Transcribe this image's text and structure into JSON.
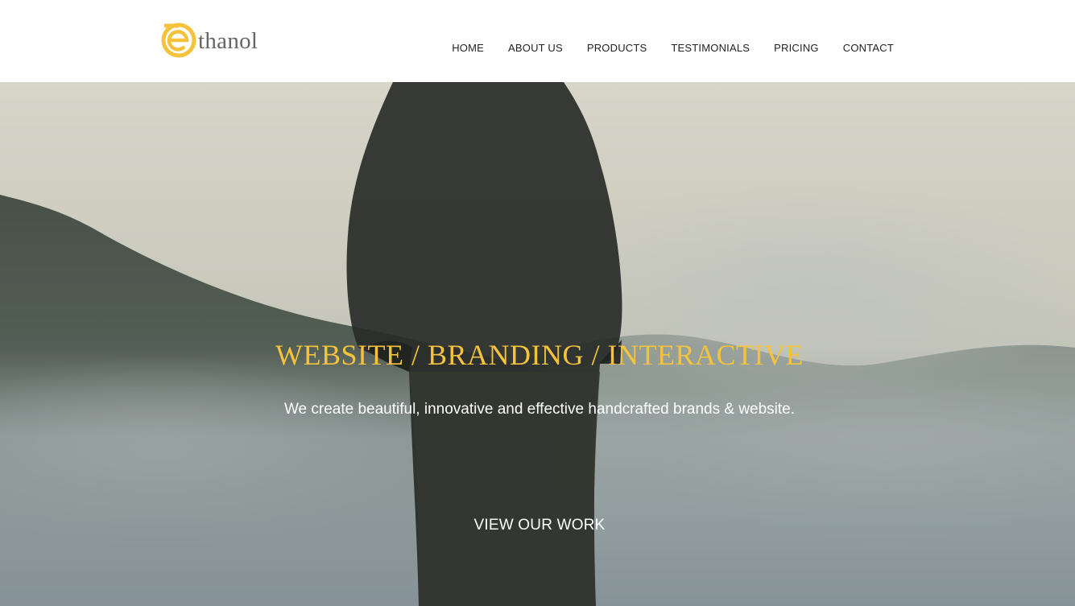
{
  "brand": {
    "logo_letter": "e",
    "name": "thanol",
    "accent_color": "#f5c33b"
  },
  "nav": {
    "items": [
      {
        "label": "HOME"
      },
      {
        "label": "ABOUT US"
      },
      {
        "label": "PRODUCTS"
      },
      {
        "label": "TESTIMONIALS"
      },
      {
        "label": "PRICING"
      },
      {
        "label": "CONTACT"
      }
    ]
  },
  "hero": {
    "title": "WEBSITE / BRANDING / INTERACTIVE",
    "subtitle": "We create beautiful, innovative and effective handcrafted brands & website.",
    "cta_label": "VIEW OUR WORK",
    "background_icon": "man-standing-in-misty-mountains-photo"
  }
}
